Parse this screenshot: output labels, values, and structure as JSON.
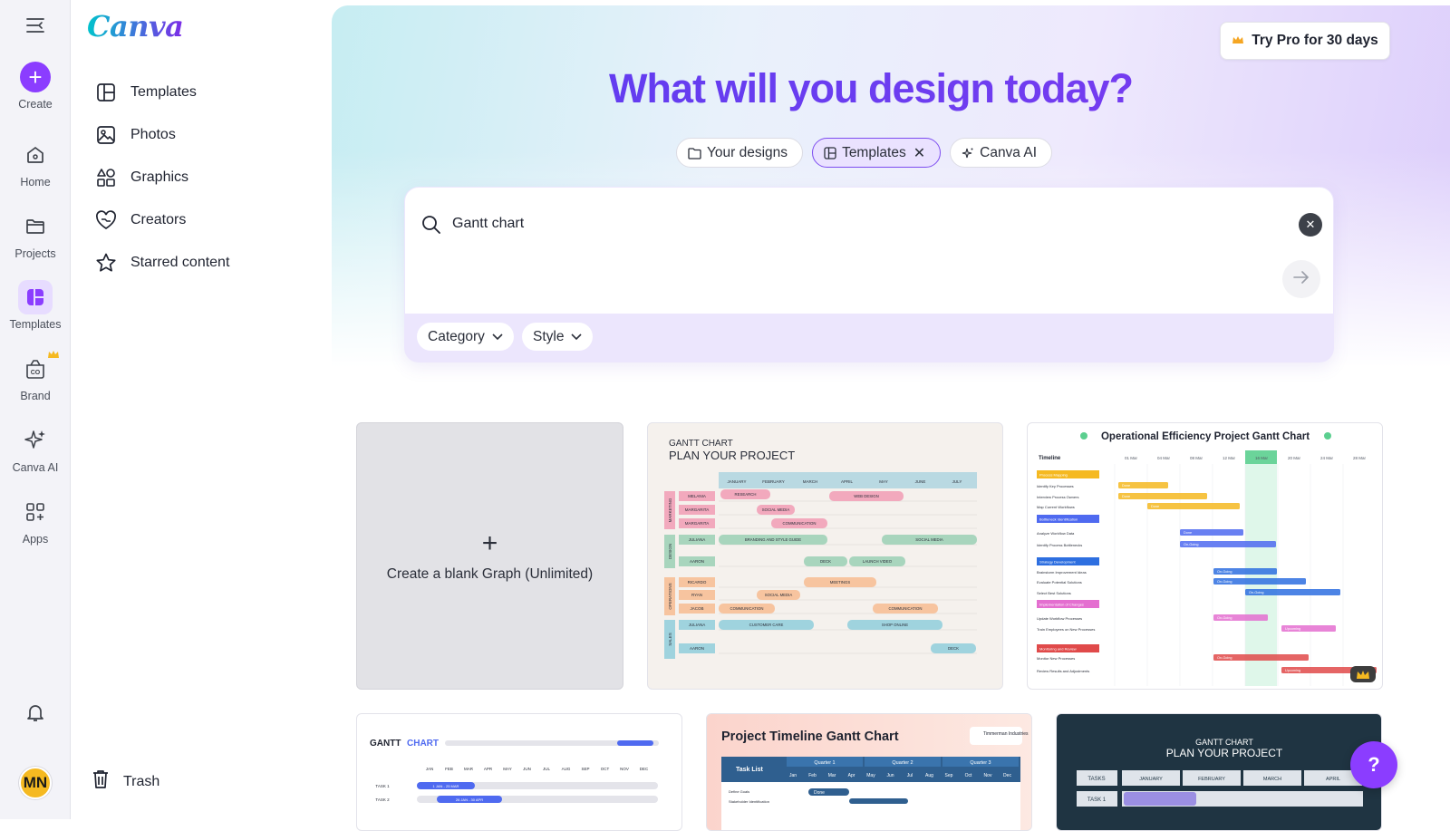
{
  "rail": {
    "items": [
      {
        "label": "Create"
      },
      {
        "label": "Home"
      },
      {
        "label": "Projects"
      },
      {
        "label": "Templates"
      },
      {
        "label": "Brand"
      },
      {
        "label": "Canva AI"
      },
      {
        "label": "Apps"
      }
    ],
    "avatar_initials": "MN"
  },
  "panel": {
    "logo": "Canva",
    "nav": [
      {
        "label": "Templates",
        "icon": "templates-icon"
      },
      {
        "label": "Photos",
        "icon": "photos-icon"
      },
      {
        "label": "Graphics",
        "icon": "graphics-icon"
      },
      {
        "label": "Creators",
        "icon": "creators-icon"
      },
      {
        "label": "Starred content",
        "icon": "star-icon"
      }
    ],
    "trash_label": "Trash"
  },
  "main": {
    "pro_button": "Try Pro for 30 days",
    "headline": "What will you design today?",
    "chips": [
      {
        "label": "Your designs"
      },
      {
        "label": "Templates"
      },
      {
        "label": "Canva AI"
      }
    ],
    "search": {
      "value": "Gantt chart"
    },
    "filters": [
      {
        "label": "Category"
      },
      {
        "label": "Style"
      }
    ],
    "blank_card_label": "Create a blank Graph (Unlimited)"
  },
  "templates": {
    "t1": {
      "title_line1": "GANTT CHART",
      "title_line2": "PLAN YOUR PROJECT",
      "months": [
        "JANUARY",
        "FEBRUARY",
        "MARCH",
        "APRIL",
        "MAY",
        "JUNE",
        "JULY"
      ],
      "groups": [
        "MARKETING",
        "DESIGN",
        "OPERATIONS",
        "SALES"
      ],
      "people": [
        "MELANIA",
        "MARGARITA",
        "MARGARITA",
        "JULIANA",
        "AARON",
        "RICARDO",
        "RYAN",
        "JACOB",
        "JULIANA",
        "AARON"
      ],
      "tasks": [
        "RESEARCH",
        "WEB DESIGN",
        "SOCIAL MEDIA",
        "COMMUNICATION",
        "BRANDING AND STYLE GUIDE",
        "SOCIAL MEDIA",
        "DECK",
        "LAUNCH VIDEO",
        "MEETINGS",
        "SOCIAL MEDIA",
        "COMMUNICATION",
        "COMMUNICATION",
        "CUSTOMER CARE",
        "SHOP ONLINE",
        "DECK"
      ]
    },
    "t2": {
      "title": "Operational Efficiency Project Gantt Chart",
      "timeline_label": "Timeline",
      "dates": [
        "01 Mar",
        "04 Mar",
        "08 Mar",
        "12 Mar",
        "16 Mar",
        "20 Mar",
        "24 Mar",
        "28 Mar"
      ],
      "sections": [
        "Process Mapping",
        "Bottleneck Identification",
        "Strategy Development",
        "Implementation of Changes",
        "Monitoring and Review"
      ],
      "rows": [
        "Identify Key Processes",
        "Interview Process Owners",
        "Map Current Workflows",
        "Analyze Workflow Data",
        "Identify Process Bottlenecks",
        "Brainstorm Improvement Ideas",
        "Evaluate Potential Solutions",
        "Select Best Solutions",
        "Update Workflow Processes",
        "Train Employees on New Processes",
        "Monitor New Processes",
        "Review Results and Adjustments"
      ],
      "statuses": [
        "Done",
        "Done",
        "Done",
        "Done",
        "On-Going",
        "On-Going",
        "On-Going",
        "On-Going",
        "On-Going",
        "Upcoming",
        "On-Going",
        "Upcoming"
      ]
    },
    "t3": {
      "title_a": "GANTT",
      "title_b": "CHART",
      "months": [
        "JAN",
        "FEB",
        "MAR",
        "APR",
        "MAY",
        "JUN",
        "JUL",
        "AUG",
        "SEP",
        "OCT",
        "NOV",
        "DEC"
      ],
      "tasks": [
        "TASK 1",
        "TASK 2"
      ],
      "bars": [
        "1 JAN - 25 MAR",
        "26 JAN - 30 APR"
      ]
    },
    "t4": {
      "title": "Project Timeline Gantt Chart",
      "company": "Timmerman Industries",
      "task_list": "Task List",
      "quarters": [
        "Quarter 1",
        "Quarter 2",
        "Quarter 3"
      ],
      "months": [
        "Jan",
        "Feb",
        "Mar",
        "Apr",
        "May",
        "Jun",
        "Jul",
        "Aug",
        "Sep",
        "Oct",
        "Nov",
        "Dec"
      ],
      "rows": [
        "Define Goals",
        "Stakeholder Identification"
      ],
      "bar": "Done"
    },
    "t5": {
      "title_line1": "GANTT CHART",
      "title_line2": "PLAN YOUR PROJECT",
      "col_header": "TASKS",
      "months": [
        "JANUARY",
        "FEBRUARY",
        "MARCH",
        "APRIL"
      ],
      "row1": "TASK 1"
    }
  },
  "help_label": "?",
  "colors": {
    "accent": "#8b3dff",
    "headline": "#5b3cf0",
    "avatar": "#f5b921"
  }
}
